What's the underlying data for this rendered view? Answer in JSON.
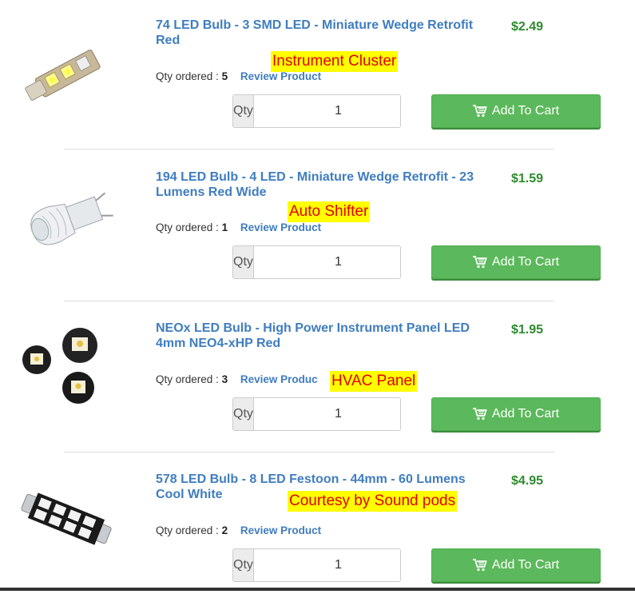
{
  "items": [
    {
      "title": "74 LED Bulb - 3 SMD LED - Miniature Wedge Retrofit Red",
      "price": "$2.49",
      "qty_ordered_label": "Qty ordered :",
      "qty_ordered": "5",
      "review_link": "Review Product",
      "qty_label": "Qty",
      "qty_value": "1",
      "cart_label": "Add To Cart",
      "annotation": "Instrument Cluster",
      "thumb_icon": "wedge-smd-bulb-icon"
    },
    {
      "title": "194 LED Bulb - 4 LED - Miniature Wedge Retrofit - 23 Lumens Red Wide",
      "price": "$1.59",
      "qty_ordered_label": "Qty ordered :",
      "qty_ordered": "1",
      "review_link": "Review Product",
      "qty_label": "Qty",
      "qty_value": "1",
      "cart_label": "Add To Cart",
      "annotation": "Auto Shifter",
      "thumb_icon": "clear-wedge-bulb-icon"
    },
    {
      "title": "NEOx LED Bulb - High Power Instrument Panel LED 4mm NEO4-xHP Red",
      "price": "$1.95",
      "qty_ordered_label": "Qty ordered :",
      "qty_ordered": "3",
      "review_link": "Review Produc",
      "qty_label": "Qty",
      "qty_value": "1",
      "cart_label": "Add To Cart",
      "annotation": "HVAC Panel",
      "thumb_icon": "neo-panel-led-icon"
    },
    {
      "title": "578 LED Bulb - 8 LED Festoon - 44mm - 60 Lumens Cool White",
      "price": "$4.95",
      "qty_ordered_label": "Qty ordered :",
      "qty_ordered": "2",
      "review_link": "Review Product",
      "qty_label": "Qty",
      "qty_value": "1",
      "cart_label": "Add To Cart",
      "annotation": "Courtesy by Sound pods",
      "thumb_icon": "festoon-bulb-icon"
    }
  ],
  "colors": {
    "title_link": "#3f7dbf",
    "price": "#2e8b2e",
    "cart_button": "#5cb85c",
    "annotation_bg": "#ffff00",
    "annotation_text": "#e00000"
  }
}
